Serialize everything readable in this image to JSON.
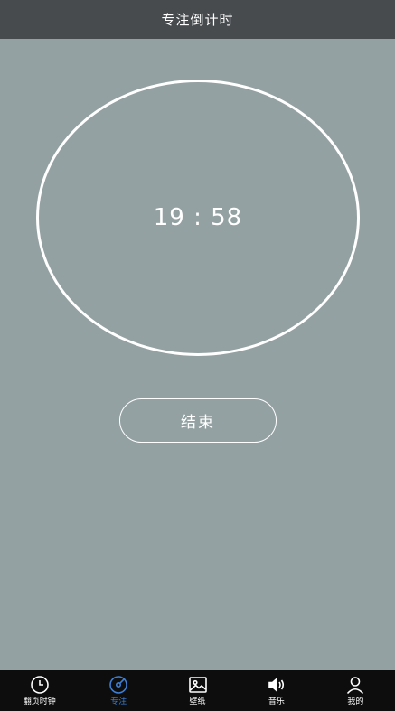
{
  "header": {
    "title": "专注倒计时"
  },
  "timer": {
    "display": "19 : 58"
  },
  "actions": {
    "end_label": "结束"
  },
  "tabs": [
    {
      "label": "翻页时钟",
      "icon": "clock-icon"
    },
    {
      "label": "专注",
      "icon": "focus-icon",
      "active": true
    },
    {
      "label": "壁纸",
      "icon": "image-icon"
    },
    {
      "label": "音乐",
      "icon": "speaker-icon"
    },
    {
      "label": "我的",
      "icon": "user-icon"
    }
  ],
  "colors": {
    "background": "#94a1a2",
    "header": "#474b4e",
    "tabbar": "#0d0d0d",
    "accent": "#3d7fd6",
    "foreground": "#ffffff"
  }
}
